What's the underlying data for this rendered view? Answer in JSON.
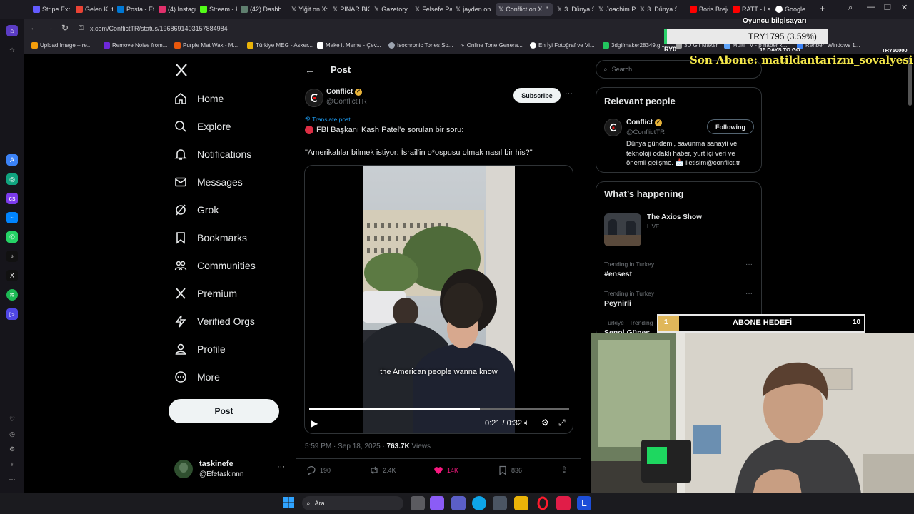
{
  "tabs": [
    {
      "label": "Stripe Exp",
      "color": "#635bff"
    },
    {
      "label": "Gelen Kutu",
      "color": "#ea4335"
    },
    {
      "label": "Posta - Efe",
      "color": "#0078d4"
    },
    {
      "label": "(4) Instagr",
      "color": "#e1306c"
    },
    {
      "label": "Stream - K",
      "color": "#53fc18"
    },
    {
      "label": "(42) Dashb",
      "color": "#5f7f6f"
    },
    {
      "label": "Yiğit on X:",
      "color": "#ffffff"
    },
    {
      "label": "PINAR BK",
      "color": "#ffffff"
    },
    {
      "label": "Gazetory",
      "color": "#ffffff"
    },
    {
      "label": "Felsefe Pa",
      "color": "#ffffff"
    },
    {
      "label": "jayden on",
      "color": "#ffffff"
    },
    {
      "label": "Conflict on X: \"",
      "color": "#ffffff",
      "active": true
    },
    {
      "label": "3. Dünya S",
      "color": "#ffffff"
    },
    {
      "label": "Joachim P",
      "color": "#ffffff"
    },
    {
      "label": "3. Dünya S",
      "color": "#ffffff"
    },
    {
      "label": "Boris Brejc",
      "color": "#ff0000"
    },
    {
      "label": "RATT - Lay",
      "color": "#ff0000"
    },
    {
      "label": "Google",
      "color": "#4285f4"
    }
  ],
  "address": {
    "url": "x.com/ConflictTR/status/1968691403157884984"
  },
  "bookmarks": [
    "Upload Image – re...",
    "Remove Noise from...",
    "Purple Mat Wax - M...",
    "Türkiye MEG - Asker...",
    "Make it Meme - Çev...",
    "Isochronic Tones So...",
    "Online Tone Genera...",
    "En İyi Fotoğraf ve Vi...",
    "3dgifmaker28349.gi...",
    "3D Gif Maker",
    "Multi TV - p haber k...",
    "Rehber: Windows 1..."
  ],
  "nav": {
    "items": [
      "Home",
      "Explore",
      "Notifications",
      "Messages",
      "Grok",
      "Bookmarks",
      "Communities",
      "Premium",
      "Verified Orgs",
      "Profile",
      "More"
    ],
    "post_button": "Post",
    "account_name": "taskinefe",
    "account_handle": "@Efetaskinnn"
  },
  "post": {
    "header_title": "Post",
    "author_name": "Conflict",
    "author_handle": "@ConflictTR",
    "subscribe_label": "Subscribe",
    "translate": "Translate post",
    "line1": "FBI Başkanı Kash Patel'e sorulan bir soru:",
    "line2": "\"Amerikalılar bilmek istiyor: İsrail'in o*ospusu olmak nasıl bir his?\"",
    "video_caption": "the American people wanna know",
    "video_time": "0:21 / 0:32",
    "video_progress": 0.656,
    "meta_time": "5:59 PM · Sep 18, 2025 ·",
    "views_count": "763.7K",
    "views_label": "Views",
    "replies": "190",
    "reposts": "2.4K",
    "likes": "14K",
    "bookmarks": "836"
  },
  "right": {
    "search_placeholder": "Search",
    "relevant_title": "Relevant people",
    "person_name": "Conflict",
    "person_handle": "@ConflictTR",
    "following_label": "Following",
    "bio": "Dünya gündemi, savunma sanayii ve teknoloji odaklı haber, yurt içi veri ve önemli gelişme. 📩 iletisim@conflict.tr",
    "happening_title": "What’s happening",
    "show_title": "The Axios Show",
    "show_status": "LIVE",
    "trends": [
      {
        "context": "Trending in Turkey",
        "name": "#ensest"
      },
      {
        "context": "Trending in Turkey",
        "name": "Peynirli"
      },
      {
        "context": "Türkiye · Trending",
        "name": "Şenol Güneş"
      }
    ]
  },
  "overlay": {
    "device_label": "Oyuncu bilgisayarı",
    "currency": "TRY1795 (3.59%)",
    "left_value": "RY0",
    "days": "15 DAYS TO GO",
    "right_value": "TRY50000",
    "last_sub": "Son Abone: matildantarizm_sovalyesi",
    "goal_current": "1",
    "goal_label": "ABONE HEDEFİ",
    "goal_target": "10",
    "goal_progress": 0.1
  },
  "taskbar": {
    "search_label": "Ara"
  }
}
